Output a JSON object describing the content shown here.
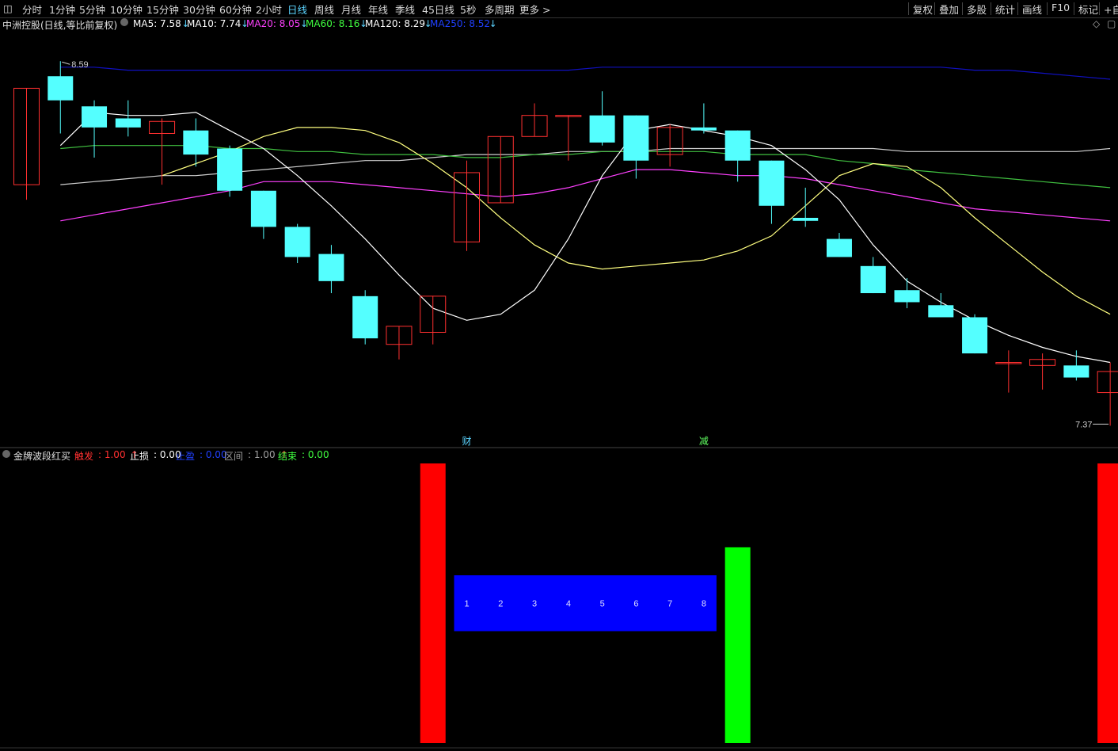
{
  "toolbar": {
    "periods": [
      "分时",
      "1分钟",
      "5分钟",
      "10分钟",
      "15分钟",
      "30分钟",
      "60分钟",
      "2小时",
      "日线",
      "周线",
      "月线",
      "年线",
      "季线",
      "45日线",
      "5秒",
      "多周期",
      "更多 >"
    ],
    "active_period": "日线",
    "right_buttons": [
      "复权",
      "叠加",
      "多股",
      "统计",
      "画线",
      "F10",
      "标记",
      "+自"
    ]
  },
  "legend": {
    "title": "中洲控股(日线,等比前复权)",
    "ma": [
      {
        "label": "MA5: 7.58",
        "arrow": "↓",
        "color": "#ffffff"
      },
      {
        "label": "MA10: 7.74",
        "arrow": "↓",
        "color": "#ffffff"
      },
      {
        "label": "MA20: 8.05",
        "arrow": "↓",
        "color": "#ff40ff"
      },
      {
        "label": "MA60: 8.16",
        "arrow": "↓",
        "color": "#40ff40"
      },
      {
        "label": "MA120: 8.29",
        "arrow": "↓",
        "color": "#ffffff"
      },
      {
        "label": "MA250: 8.52",
        "arrow": "↓",
        "color": "#2040ff"
      }
    ]
  },
  "indicator_legend": {
    "name": "金牌波段红买",
    "items": [
      {
        "label": "触发",
        "value": "1.00",
        "arrow": "↑",
        "color": "#ff3030"
      },
      {
        "label": "止损",
        "value": "0.00",
        "arrow": "",
        "color": "#ffffff"
      },
      {
        "label": "止盈",
        "value": "0.00",
        "arrow": "",
        "color": "#2040ff"
      },
      {
        "label": "区间",
        "value": "1.00",
        "arrow": "↑",
        "color": "#a0a0a0"
      },
      {
        "label": "结束",
        "value": "0.00",
        "arrow": "",
        "color": "#40ff40"
      }
    ]
  },
  "chart_data": [
    {
      "type": "candlestick",
      "high_label": "8.59",
      "low_label": "7.37",
      "markers": [
        {
          "index": 13,
          "text": "财",
          "color": "#5bd4ff"
        },
        {
          "index": 20,
          "text": "减",
          "color": "#60ff60"
        }
      ],
      "ylim": [
        7.35,
        8.62
      ],
      "candles": [
        {
          "o": 8.17,
          "h": 8.42,
          "l": 8.12,
          "c": 8.49
        },
        {
          "o": 8.53,
          "h": 8.58,
          "l": 8.34,
          "c": 8.45
        },
        {
          "o": 8.43,
          "h": 8.45,
          "l": 8.26,
          "c": 8.36
        },
        {
          "o": 8.39,
          "h": 8.45,
          "l": 8.33,
          "c": 8.36
        },
        {
          "o": 8.34,
          "h": 8.39,
          "l": 8.17,
          "c": 8.38
        },
        {
          "o": 8.35,
          "h": 8.39,
          "l": 8.23,
          "c": 8.27
        },
        {
          "o": 8.29,
          "h": 8.3,
          "l": 8.13,
          "c": 8.15
        },
        {
          "o": 8.15,
          "h": 8.15,
          "l": 7.99,
          "c": 8.03
        },
        {
          "o": 8.03,
          "h": 8.04,
          "l": 7.91,
          "c": 7.93
        },
        {
          "o": 7.94,
          "h": 7.97,
          "l": 7.81,
          "c": 7.85
        },
        {
          "o": 7.8,
          "h": 7.82,
          "l": 7.64,
          "c": 7.66
        },
        {
          "o": 7.64,
          "h": 7.68,
          "l": 7.59,
          "c": 7.7
        },
        {
          "o": 7.68,
          "h": 7.73,
          "l": 7.64,
          "c": 7.8
        },
        {
          "o": 7.98,
          "h": 8.25,
          "l": 7.95,
          "c": 8.21
        },
        {
          "o": 8.11,
          "h": 8.3,
          "l": 8.11,
          "c": 8.33
        },
        {
          "o": 8.33,
          "h": 8.44,
          "l": 8.33,
          "c": 8.4
        },
        {
          "o": 8.4,
          "h": 8.4,
          "l": 8.25,
          "c": 8.4
        },
        {
          "o": 8.4,
          "h": 8.48,
          "l": 8.3,
          "c": 8.31
        },
        {
          "o": 8.4,
          "h": 8.4,
          "l": 8.19,
          "c": 8.25
        },
        {
          "o": 8.27,
          "h": 8.37,
          "l": 8.23,
          "c": 8.36
        },
        {
          "o": 8.36,
          "h": 8.44,
          "l": 8.34,
          "c": 8.35
        },
        {
          "o": 8.35,
          "h": 8.35,
          "l": 8.18,
          "c": 8.25
        },
        {
          "o": 8.25,
          "h": 8.25,
          "l": 8.04,
          "c": 8.1
        },
        {
          "o": 8.06,
          "h": 8.16,
          "l": 8.03,
          "c": 8.05
        },
        {
          "o": 7.99,
          "h": 8.01,
          "l": 7.95,
          "c": 7.93
        },
        {
          "o": 7.9,
          "h": 7.93,
          "l": 7.82,
          "c": 7.81
        },
        {
          "o": 7.82,
          "h": 7.86,
          "l": 7.76,
          "c": 7.78
        },
        {
          "o": 7.77,
          "h": 7.81,
          "l": 7.73,
          "c": 7.73
        },
        {
          "o": 7.73,
          "h": 7.74,
          "l": 7.61,
          "c": 7.61
        },
        {
          "o": 7.58,
          "h": 7.62,
          "l": 7.48,
          "c": 7.58
        },
        {
          "o": 7.57,
          "h": 7.61,
          "l": 7.49,
          "c": 7.59
        },
        {
          "o": 7.57,
          "h": 7.62,
          "l": 7.52,
          "c": 7.53
        },
        {
          "o": 7.48,
          "h": 7.58,
          "l": 7.37,
          "c": 7.55
        }
      ],
      "ma5": [
        8.3,
        8.41,
        8.4,
        8.4,
        8.41,
        8.35,
        8.29,
        8.2,
        8.1,
        7.99,
        7.87,
        7.76,
        7.72,
        7.74,
        7.82,
        7.99,
        8.2,
        8.35,
        8.37,
        8.35,
        8.33,
        8.3,
        8.22,
        8.12,
        7.97,
        7.85,
        7.78,
        7.72,
        7.67,
        7.63,
        7.6,
        7.58
      ],
      "ma10": [
        8.2,
        8.24,
        8.28,
        8.33,
        8.36,
        8.36,
        8.35,
        8.31,
        8.24,
        8.16,
        8.06,
        7.97,
        7.91,
        7.89,
        7.9,
        7.91,
        7.92,
        7.95,
        8.0,
        8.1,
        8.2,
        8.24,
        8.23,
        8.16,
        8.06,
        7.97,
        7.88,
        7.8,
        7.74
      ],
      "ma20": [
        8.05,
        8.07,
        8.09,
        8.11,
        8.13,
        8.15,
        8.18,
        8.18,
        8.18,
        8.17,
        8.16,
        8.15,
        8.14,
        8.13,
        8.14,
        8.16,
        8.19,
        8.22,
        8.22,
        8.21,
        8.2,
        8.2,
        8.19,
        8.17,
        8.15,
        8.13,
        8.11,
        8.09,
        8.08,
        8.07,
        8.06,
        8.05
      ],
      "ma60": [
        8.29,
        8.3,
        8.3,
        8.3,
        8.3,
        8.29,
        8.29,
        8.28,
        8.28,
        8.27,
        8.27,
        8.27,
        8.26,
        8.26,
        8.27,
        8.27,
        8.28,
        8.28,
        8.28,
        8.28,
        8.27,
        8.27,
        8.27,
        8.25,
        8.24,
        8.22,
        8.21,
        8.2,
        8.19,
        8.18,
        8.17,
        8.16
      ],
      "ma120": [
        8.17,
        8.18,
        8.19,
        8.2,
        8.2,
        8.21,
        8.22,
        8.23,
        8.24,
        8.25,
        8.25,
        8.26,
        8.27,
        8.27,
        8.27,
        8.28,
        8.28,
        8.28,
        8.29,
        8.29,
        8.29,
        8.29,
        8.29,
        8.29,
        8.29,
        8.28,
        8.28,
        8.28,
        8.28,
        8.28,
        8.28,
        8.29
      ],
      "ma250": [
        8.56,
        8.56,
        8.55,
        8.55,
        8.55,
        8.55,
        8.55,
        8.55,
        8.55,
        8.55,
        8.55,
        8.55,
        8.55,
        8.55,
        8.55,
        8.55,
        8.56,
        8.56,
        8.56,
        8.56,
        8.56,
        8.56,
        8.56,
        8.56,
        8.56,
        8.56,
        8.56,
        8.55,
        8.55,
        8.54,
        8.53,
        8.52
      ]
    },
    {
      "type": "bar",
      "bars": [
        {
          "start": 12,
          "end": 12,
          "level": 1.0,
          "color": "#ff0000"
        },
        {
          "start": 13,
          "end": 20,
          "level": 0.6,
          "base": 0.4,
          "color": "#0000ff",
          "labels": [
            "1",
            "2",
            "3",
            "4",
            "5",
            "6",
            "7",
            "8"
          ]
        },
        {
          "start": 21,
          "end": 21,
          "level": 0.7,
          "color": "#00ff00"
        },
        {
          "start": 32,
          "end": 32,
          "level": 1.0,
          "color": "#ff0000"
        }
      ]
    }
  ],
  "colors": {
    "up": "#ff3030",
    "down": "#54ffff",
    "ma5": "#ffffff",
    "ma10": "#ffff80",
    "ma20": "#ff40ff",
    "ma60": "#40c040",
    "ma120": "#d0d0d0",
    "ma250": "#1010c0"
  }
}
